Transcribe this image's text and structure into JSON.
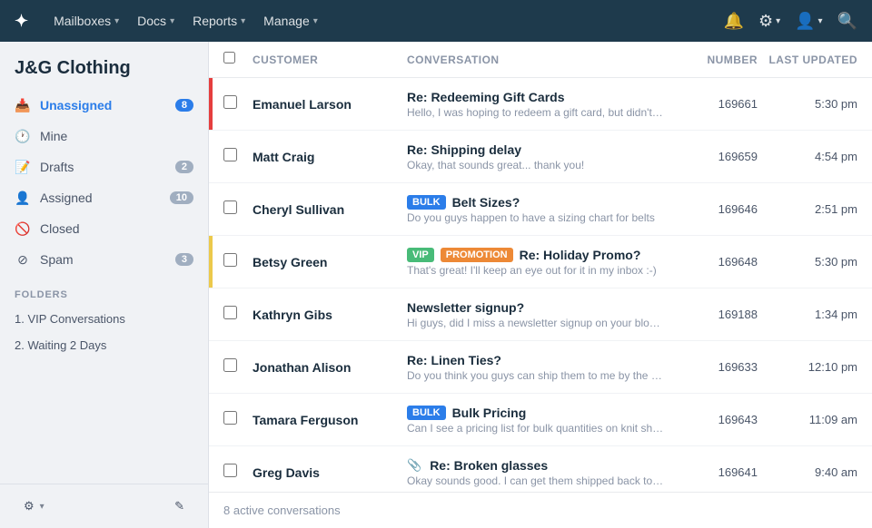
{
  "topnav": {
    "logo": "✦",
    "items": [
      {
        "label": "Mailboxes",
        "id": "mailboxes"
      },
      {
        "label": "Docs",
        "id": "docs"
      },
      {
        "label": "Reports",
        "id": "reports"
      },
      {
        "label": "Manage",
        "id": "manage"
      }
    ],
    "icons": [
      "bell",
      "user-circle",
      "avatar",
      "search"
    ]
  },
  "sidebar": {
    "company": "J&G Clothing",
    "nav_items": [
      {
        "id": "unassigned",
        "label": "Unassigned",
        "badge": "8",
        "active": true
      },
      {
        "id": "mine",
        "label": "Mine",
        "badge": "",
        "active": false
      },
      {
        "id": "drafts",
        "label": "Drafts",
        "badge": "2",
        "active": false
      },
      {
        "id": "assigned",
        "label": "Assigned",
        "badge": "10",
        "active": false
      },
      {
        "id": "closed",
        "label": "Closed",
        "badge": "",
        "active": false
      },
      {
        "id": "spam",
        "label": "Spam",
        "badge": "3",
        "active": false
      }
    ],
    "folders_title": "FOLDERS",
    "folders": [
      {
        "id": "vip",
        "label": "1. VIP Conversations"
      },
      {
        "id": "waiting",
        "label": "2. Waiting 2 Days"
      }
    ],
    "settings_label": "⚙",
    "new_label": "✎"
  },
  "table": {
    "headers": {
      "customer": "Customer",
      "conversation": "Conversation",
      "number": "Number",
      "last_updated": "Last Updated"
    },
    "rows": [
      {
        "id": 1,
        "customer": "Emanuel Larson",
        "title": "Re: Redeeming Gift Cards",
        "preview": "Hello, I was hoping to redeem a gift card, but didn't see a price",
        "number": "169661",
        "updated": "5:30 pm",
        "indicator": "red",
        "tags": [],
        "attachment": false
      },
      {
        "id": 2,
        "customer": "Matt Craig",
        "title": "Re: Shipping delay",
        "preview": "Okay, that sounds great... thank you!",
        "number": "169659",
        "updated": "4:54 pm",
        "indicator": "",
        "tags": [],
        "attachment": false
      },
      {
        "id": 3,
        "customer": "Cheryl Sullivan",
        "title": "Belt Sizes?",
        "preview": "Do you guys happen to have a sizing chart for belts",
        "number": "169646",
        "updated": "2:51 pm",
        "indicator": "",
        "tags": [
          "bulk"
        ],
        "attachment": false
      },
      {
        "id": 4,
        "customer": "Betsy Green",
        "title": "Re: Holiday Promo?",
        "preview": "That's great! I'll keep an eye out for it in my inbox :-)",
        "number": "169648",
        "updated": "5:30 pm",
        "indicator": "yellow",
        "tags": [
          "vip",
          "promotion"
        ],
        "attachment": false
      },
      {
        "id": 5,
        "customer": "Kathryn Gibs",
        "title": "Newsletter signup?",
        "preview": "Hi guys, did I miss a newsletter signup on your blog? I'd love",
        "number": "169188",
        "updated": "1:34 pm",
        "indicator": "",
        "tags": [],
        "attachment": false
      },
      {
        "id": 6,
        "customer": "Jonathan Alison",
        "title": "Re: Linen Ties?",
        "preview": "Do you think you guys can ship them to me by the end of the wee",
        "number": "169633",
        "updated": "12:10 pm",
        "indicator": "",
        "tags": [],
        "attachment": false
      },
      {
        "id": 7,
        "customer": "Tamara Ferguson",
        "title": "Bulk Pricing",
        "preview": "Can I see a pricing list for bulk quantities on knit shirts?",
        "number": "169643",
        "updated": "11:09 am",
        "indicator": "",
        "tags": [
          "bulk"
        ],
        "attachment": false
      },
      {
        "id": 8,
        "customer": "Greg Davis",
        "title": "Re: Broken glasses",
        "preview": "Okay sounds good. I can get them shipped back to you by friday",
        "number": "169641",
        "updated": "9:40 am",
        "indicator": "",
        "tags": [],
        "attachment": true
      }
    ],
    "footer": "8 active conversations"
  }
}
